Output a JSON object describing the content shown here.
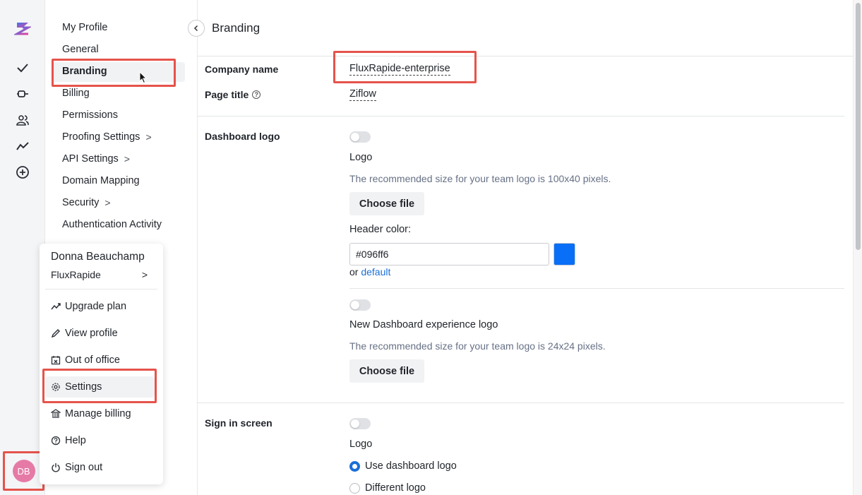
{
  "rail": {
    "icons": [
      "app-logo-icon",
      "check-icon",
      "proof-icon",
      "users-icon",
      "activity-icon",
      "plus-circle-icon"
    ],
    "avatar_initials": "DB",
    "avatar_color": "#e67aa7"
  },
  "settings_nav": {
    "items": [
      {
        "label": "My Profile"
      },
      {
        "label": "General"
      },
      {
        "label": "Branding"
      },
      {
        "label": "Billing"
      },
      {
        "label": "Permissions"
      },
      {
        "label": "Proofing Settings",
        "chevron": ">"
      },
      {
        "label": "API Settings",
        "chevron": ">"
      },
      {
        "label": "Domain Mapping"
      },
      {
        "label": "Security",
        "chevron": ">"
      },
      {
        "label": "Authentication Activity"
      }
    ],
    "active": "Branding"
  },
  "user_menu": {
    "name": "Donna Beauchamp",
    "org": "FluxRapide",
    "org_chevron": ">",
    "items": [
      {
        "label": "Upgrade plan",
        "icon": "trend-up-icon"
      },
      {
        "label": "View profile",
        "icon": "pencil-icon"
      },
      {
        "label": "Out of office",
        "icon": "calendar-x-icon"
      },
      {
        "label": "Settings",
        "icon": "gear-icon"
      },
      {
        "label": "Manage billing",
        "icon": "bank-icon"
      },
      {
        "label": "Help",
        "icon": "help-circle-icon"
      },
      {
        "label": "Sign out",
        "icon": "power-icon"
      }
    ]
  },
  "main": {
    "title": "Branding",
    "company_name_label": "Company name",
    "company_name_value": "FluxRapide-enterprise",
    "page_title_label": "Page title",
    "page_title_value": "Ziflow",
    "dashboard_logo": {
      "label": "Dashboard logo",
      "logo_label": "Logo",
      "logo_hint": "The recommended size for your team logo is 100x40 pixels.",
      "choose_file": "Choose file",
      "header_color_label": "Header color:",
      "header_color_value": "#096ff6",
      "or_text": "or",
      "default_link": "default",
      "new_logo_label": "New Dashboard experience logo",
      "new_logo_hint": "The recommended size for your team logo is 24x24 pixels.",
      "choose_file_2": "Choose file"
    },
    "sign_in": {
      "label": "Sign in screen",
      "logo_label": "Logo",
      "option_1": "Use dashboard logo",
      "option_2": "Different logo"
    }
  },
  "colors": {
    "accent": "#1a6fd8",
    "highlight": "#e5534b",
    "swatch": "#096ff6"
  }
}
